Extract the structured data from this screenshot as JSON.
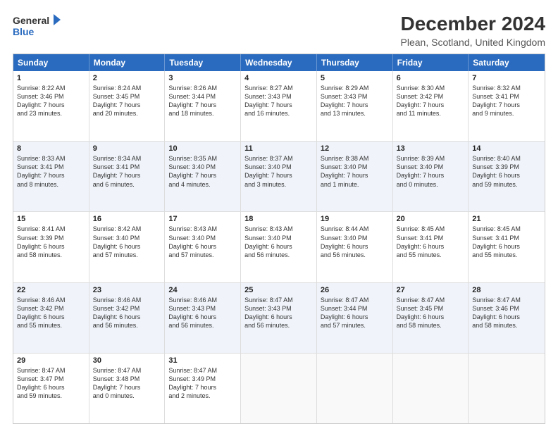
{
  "header": {
    "logo_line1": "General",
    "logo_line2": "Blue",
    "main_title": "December 2024",
    "subtitle": "Plean, Scotland, United Kingdom"
  },
  "days_of_week": [
    "Sunday",
    "Monday",
    "Tuesday",
    "Wednesday",
    "Thursday",
    "Friday",
    "Saturday"
  ],
  "rows": [
    [
      {
        "day": "1",
        "lines": [
          "Sunrise: 8:22 AM",
          "Sunset: 3:46 PM",
          "Daylight: 7 hours",
          "and 23 minutes."
        ]
      },
      {
        "day": "2",
        "lines": [
          "Sunrise: 8:24 AM",
          "Sunset: 3:45 PM",
          "Daylight: 7 hours",
          "and 20 minutes."
        ]
      },
      {
        "day": "3",
        "lines": [
          "Sunrise: 8:26 AM",
          "Sunset: 3:44 PM",
          "Daylight: 7 hours",
          "and 18 minutes."
        ]
      },
      {
        "day": "4",
        "lines": [
          "Sunrise: 8:27 AM",
          "Sunset: 3:43 PM",
          "Daylight: 7 hours",
          "and 16 minutes."
        ]
      },
      {
        "day": "5",
        "lines": [
          "Sunrise: 8:29 AM",
          "Sunset: 3:43 PM",
          "Daylight: 7 hours",
          "and 13 minutes."
        ]
      },
      {
        "day": "6",
        "lines": [
          "Sunrise: 8:30 AM",
          "Sunset: 3:42 PM",
          "Daylight: 7 hours",
          "and 11 minutes."
        ]
      },
      {
        "day": "7",
        "lines": [
          "Sunrise: 8:32 AM",
          "Sunset: 3:41 PM",
          "Daylight: 7 hours",
          "and 9 minutes."
        ]
      }
    ],
    [
      {
        "day": "8",
        "lines": [
          "Sunrise: 8:33 AM",
          "Sunset: 3:41 PM",
          "Daylight: 7 hours",
          "and 8 minutes."
        ]
      },
      {
        "day": "9",
        "lines": [
          "Sunrise: 8:34 AM",
          "Sunset: 3:41 PM",
          "Daylight: 7 hours",
          "and 6 minutes."
        ]
      },
      {
        "day": "10",
        "lines": [
          "Sunrise: 8:35 AM",
          "Sunset: 3:40 PM",
          "Daylight: 7 hours",
          "and 4 minutes."
        ]
      },
      {
        "day": "11",
        "lines": [
          "Sunrise: 8:37 AM",
          "Sunset: 3:40 PM",
          "Daylight: 7 hours",
          "and 3 minutes."
        ]
      },
      {
        "day": "12",
        "lines": [
          "Sunrise: 8:38 AM",
          "Sunset: 3:40 PM",
          "Daylight: 7 hours",
          "and 1 minute."
        ]
      },
      {
        "day": "13",
        "lines": [
          "Sunrise: 8:39 AM",
          "Sunset: 3:40 PM",
          "Daylight: 7 hours",
          "and 0 minutes."
        ]
      },
      {
        "day": "14",
        "lines": [
          "Sunrise: 8:40 AM",
          "Sunset: 3:39 PM",
          "Daylight: 6 hours",
          "and 59 minutes."
        ]
      }
    ],
    [
      {
        "day": "15",
        "lines": [
          "Sunrise: 8:41 AM",
          "Sunset: 3:39 PM",
          "Daylight: 6 hours",
          "and 58 minutes."
        ]
      },
      {
        "day": "16",
        "lines": [
          "Sunrise: 8:42 AM",
          "Sunset: 3:40 PM",
          "Daylight: 6 hours",
          "and 57 minutes."
        ]
      },
      {
        "day": "17",
        "lines": [
          "Sunrise: 8:43 AM",
          "Sunset: 3:40 PM",
          "Daylight: 6 hours",
          "and 57 minutes."
        ]
      },
      {
        "day": "18",
        "lines": [
          "Sunrise: 8:43 AM",
          "Sunset: 3:40 PM",
          "Daylight: 6 hours",
          "and 56 minutes."
        ]
      },
      {
        "day": "19",
        "lines": [
          "Sunrise: 8:44 AM",
          "Sunset: 3:40 PM",
          "Daylight: 6 hours",
          "and 56 minutes."
        ]
      },
      {
        "day": "20",
        "lines": [
          "Sunrise: 8:45 AM",
          "Sunset: 3:41 PM",
          "Daylight: 6 hours",
          "and 55 minutes."
        ]
      },
      {
        "day": "21",
        "lines": [
          "Sunrise: 8:45 AM",
          "Sunset: 3:41 PM",
          "Daylight: 6 hours",
          "and 55 minutes."
        ]
      }
    ],
    [
      {
        "day": "22",
        "lines": [
          "Sunrise: 8:46 AM",
          "Sunset: 3:42 PM",
          "Daylight: 6 hours",
          "and 55 minutes."
        ]
      },
      {
        "day": "23",
        "lines": [
          "Sunrise: 8:46 AM",
          "Sunset: 3:42 PM",
          "Daylight: 6 hours",
          "and 56 minutes."
        ]
      },
      {
        "day": "24",
        "lines": [
          "Sunrise: 8:46 AM",
          "Sunset: 3:43 PM",
          "Daylight: 6 hours",
          "and 56 minutes."
        ]
      },
      {
        "day": "25",
        "lines": [
          "Sunrise: 8:47 AM",
          "Sunset: 3:43 PM",
          "Daylight: 6 hours",
          "and 56 minutes."
        ]
      },
      {
        "day": "26",
        "lines": [
          "Sunrise: 8:47 AM",
          "Sunset: 3:44 PM",
          "Daylight: 6 hours",
          "and 57 minutes."
        ]
      },
      {
        "day": "27",
        "lines": [
          "Sunrise: 8:47 AM",
          "Sunset: 3:45 PM",
          "Daylight: 6 hours",
          "and 58 minutes."
        ]
      },
      {
        "day": "28",
        "lines": [
          "Sunrise: 8:47 AM",
          "Sunset: 3:46 PM",
          "Daylight: 6 hours",
          "and 58 minutes."
        ]
      }
    ],
    [
      {
        "day": "29",
        "lines": [
          "Sunrise: 8:47 AM",
          "Sunset: 3:47 PM",
          "Daylight: 6 hours",
          "and 59 minutes."
        ]
      },
      {
        "day": "30",
        "lines": [
          "Sunrise: 8:47 AM",
          "Sunset: 3:48 PM",
          "Daylight: 7 hours",
          "and 0 minutes."
        ]
      },
      {
        "day": "31",
        "lines": [
          "Sunrise: 8:47 AM",
          "Sunset: 3:49 PM",
          "Daylight: 7 hours",
          "and 2 minutes."
        ]
      },
      {
        "day": "",
        "lines": []
      },
      {
        "day": "",
        "lines": []
      },
      {
        "day": "",
        "lines": []
      },
      {
        "day": "",
        "lines": []
      }
    ]
  ]
}
